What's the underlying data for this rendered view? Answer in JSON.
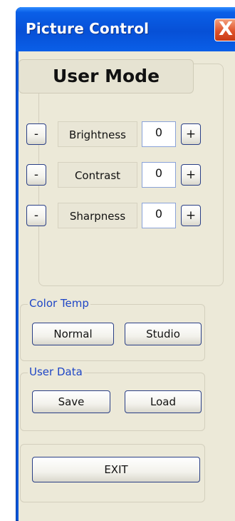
{
  "window": {
    "title": "Picture Control",
    "close_glyph": "X"
  },
  "mode": {
    "label": "User Mode"
  },
  "params": [
    {
      "label": "Brightness",
      "value": "0",
      "minus": "-",
      "plus": "+"
    },
    {
      "label": "Contrast",
      "value": "0",
      "minus": "-",
      "plus": "+"
    },
    {
      "label": "Sharpness",
      "value": "0",
      "minus": "-",
      "plus": "+"
    }
  ],
  "color_temp": {
    "legend": "Color Temp",
    "normal_label": "Normal",
    "studio_label": "Studio"
  },
  "user_data": {
    "legend": "User Data",
    "save_label": "Save",
    "load_label": "Load"
  },
  "exit_label": "EXIT",
  "colors": {
    "titlebar": "#0a5fe8",
    "client_bg": "#ece9d8",
    "legend_text": "#1f46c6",
    "close_button": "#e0532b"
  }
}
